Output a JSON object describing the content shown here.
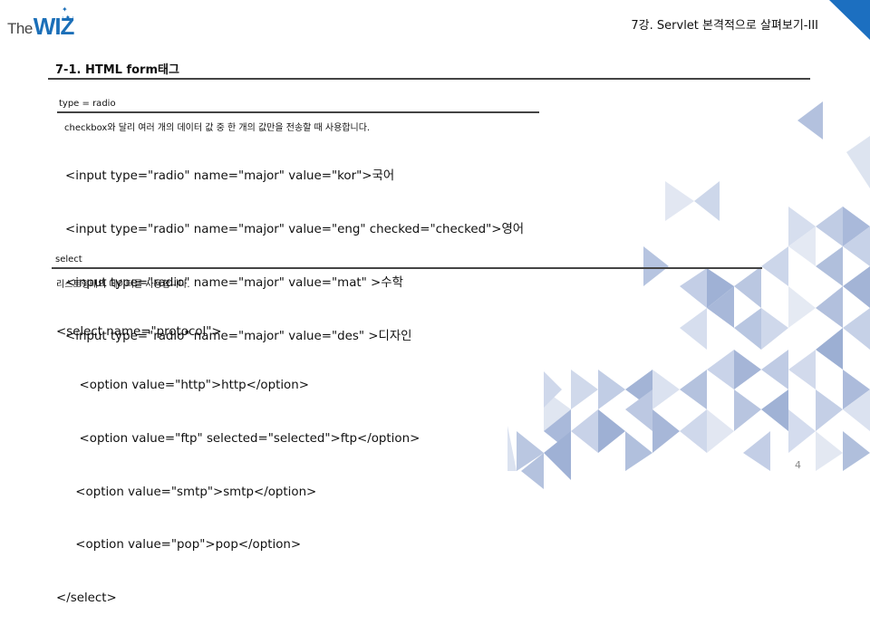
{
  "header": {
    "logo_prefix": "The",
    "logo_brand": "WIZ",
    "title": "7강. Servlet 본격적으로 살펴보기-III"
  },
  "section": {
    "title": "7-1. HTML form태그"
  },
  "radio": {
    "label": "type = radio",
    "description": "checkbox와 달리 여러 개의 데이터 값 중 한 개의 값만을 전송할 때 사용합니다.",
    "code_lines": [
      "<input type=\"radio\" name=\"major\" value=\"kor\">국어",
      "<input type=\"radio\" name=\"major\" value=\"eng\" checked=\"checked\">영어",
      "<input type=\"radio\" name=\"major\" value=\"mat\" >수학",
      "<input type=\"radio\" name=\"major\" value=\"des\" >디자인"
    ]
  },
  "select": {
    "label": "select",
    "description": "리스트형태의 데이터를 사용합니다.",
    "code_lines": [
      "<select name=\"protocol\">",
      "      <option value=\"http\">http</option>",
      "      <option value=\"ftp\" selected=\"selected\">ftp</option>",
      "     <option value=\"smtp\">smtp</option>",
      "     <option value=\"pop\">pop</option>",
      "</select>"
    ]
  },
  "footer": {
    "page_number": "4"
  },
  "colors": {
    "brand_blue": "#1b6fb8",
    "corner_blue": "#1c6fc0",
    "triangle_palette": [
      "#a3b4d6",
      "#b7c5e0",
      "#cbd5ea",
      "#dfe5f1",
      "#8fa3cc"
    ]
  }
}
